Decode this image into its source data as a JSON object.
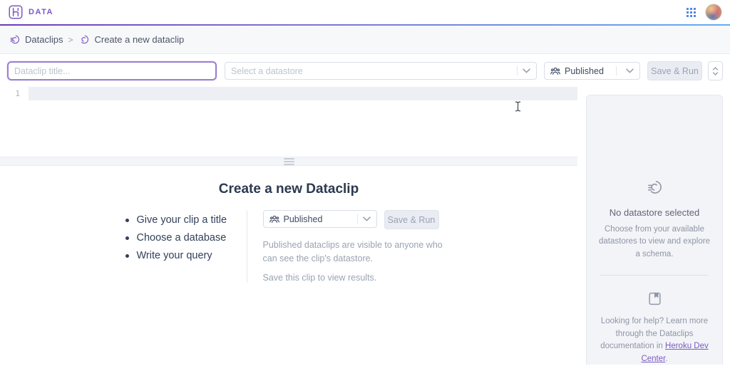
{
  "header": {
    "brand_label": "DATA"
  },
  "breadcrumb": {
    "separator": ">",
    "items": [
      {
        "label": "Dataclips"
      },
      {
        "label": "Create a new dataclip"
      }
    ]
  },
  "toolbar": {
    "title_placeholder": "Dataclip title...",
    "datastore_placeholder": "Select a datastore",
    "visibility_value": "Published",
    "save_run_label": "Save & Run"
  },
  "editor": {
    "line_number": "1"
  },
  "empty_state": {
    "title": "Create a new Dataclip",
    "steps": [
      "Give your clip a title",
      "Choose a database",
      "Write your query"
    ],
    "visibility_value": "Published",
    "save_run_label": "Save & Run",
    "visibility_help": "Published dataclips are visible to anyone who can see the clip's datastore.",
    "save_help": "Save this clip to view results."
  },
  "sidebar": {
    "empty_title": "No datastore selected",
    "empty_text": "Choose from your available datastores to view and explore a schema.",
    "help_text": "Looking for help? Learn more through the Dataclips documentation in",
    "help_link": "Heroku Dev Center",
    "help_suffix": "."
  },
  "colors": {
    "brand_purple": "#7b59c4",
    "gradient_left": "#6b3ab8",
    "gradient_right": "#63aef2",
    "text_dark": "#2b3950",
    "text_muted": "#9aa3b2",
    "link_purple": "#7a5bc2",
    "grid_icon_blue": "#4c86e8"
  }
}
